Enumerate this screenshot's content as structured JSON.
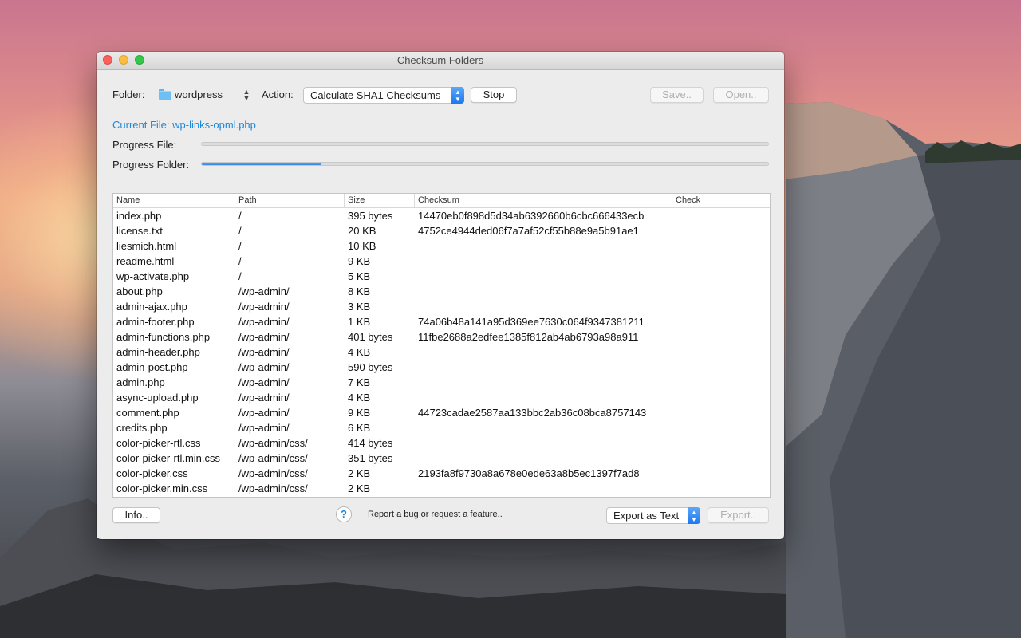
{
  "window": {
    "title": "Checksum Folders"
  },
  "toolbar": {
    "folder_label": "Folder:",
    "folder_value": "wordpress",
    "action_label": "Action:",
    "action_value": "Calculate SHA1 Checksums",
    "stop_label": "Stop",
    "save_label": "Save..",
    "open_label": "Open.."
  },
  "status": {
    "current_file": "Current File: wp-links-opml.php",
    "progress_file_label": "Progress File:",
    "progress_folder_label": "Progress Folder:",
    "progress_file_value": 0,
    "progress_folder_value": 0.21
  },
  "table": {
    "headers": [
      "Name",
      "Path",
      "Size",
      "Checksum",
      "Check"
    ],
    "rows": [
      [
        "index.php",
        "/",
        "395 bytes",
        "14470eb0f898d5d34ab6392660b6cbc666433ecb",
        ""
      ],
      [
        "license.txt",
        "/",
        "20 KB",
        "4752ce4944ded06f7a7af52cf55b88e9a5b91ae1",
        ""
      ],
      [
        "liesmich.html",
        "/",
        "10 KB",
        "",
        ""
      ],
      [
        "readme.html",
        "/",
        "9 KB",
        "",
        ""
      ],
      [
        "wp-activate.php",
        "/",
        "5 KB",
        "",
        ""
      ],
      [
        "about.php",
        "/wp-admin/",
        "8 KB",
        "",
        ""
      ],
      [
        "admin-ajax.php",
        "/wp-admin/",
        "3 KB",
        "",
        ""
      ],
      [
        "admin-footer.php",
        "/wp-admin/",
        "1 KB",
        "74a06b48a141a95d369ee7630c064f9347381211",
        ""
      ],
      [
        "admin-functions.php",
        "/wp-admin/",
        "401 bytes",
        "11fbe2688a2edfee1385f812ab4ab6793a98a911",
        ""
      ],
      [
        "admin-header.php",
        "/wp-admin/",
        "4 KB",
        "",
        ""
      ],
      [
        "admin-post.php",
        "/wp-admin/",
        "590 bytes",
        "",
        ""
      ],
      [
        "admin.php",
        "/wp-admin/",
        "7 KB",
        "",
        ""
      ],
      [
        "async-upload.php",
        "/wp-admin/",
        "4 KB",
        "",
        ""
      ],
      [
        "comment.php",
        "/wp-admin/",
        "9 KB",
        "44723cadae2587aa133bbc2ab36c08bca8757143",
        ""
      ],
      [
        "credits.php",
        "/wp-admin/",
        "6 KB",
        "",
        ""
      ],
      [
        "color-picker-rtl.css",
        "/wp-admin/css/",
        "414 bytes",
        "",
        ""
      ],
      [
        "color-picker-rtl.min.css",
        "/wp-admin/css/",
        "351 bytes",
        "",
        ""
      ],
      [
        "color-picker.css",
        "/wp-admin/css/",
        "2 KB",
        "2193fa8f9730a8a678e0ede63a8b5ec1397f7ad8",
        ""
      ],
      [
        "color-picker.min.css",
        "/wp-admin/css/",
        "2 KB",
        "",
        ""
      ]
    ]
  },
  "footer": {
    "info_label": "Info..",
    "help_glyph": "?",
    "report_text": "Report a bug or request a feature..",
    "export_format": "Export as Text",
    "export_label": "Export.."
  },
  "icons": {
    "folder": "folder-icon",
    "help": "help-icon",
    "stepper": "updown-chevron-icon"
  },
  "colors": {
    "accent": "#1e88d8",
    "progress": "#2f84e8"
  }
}
